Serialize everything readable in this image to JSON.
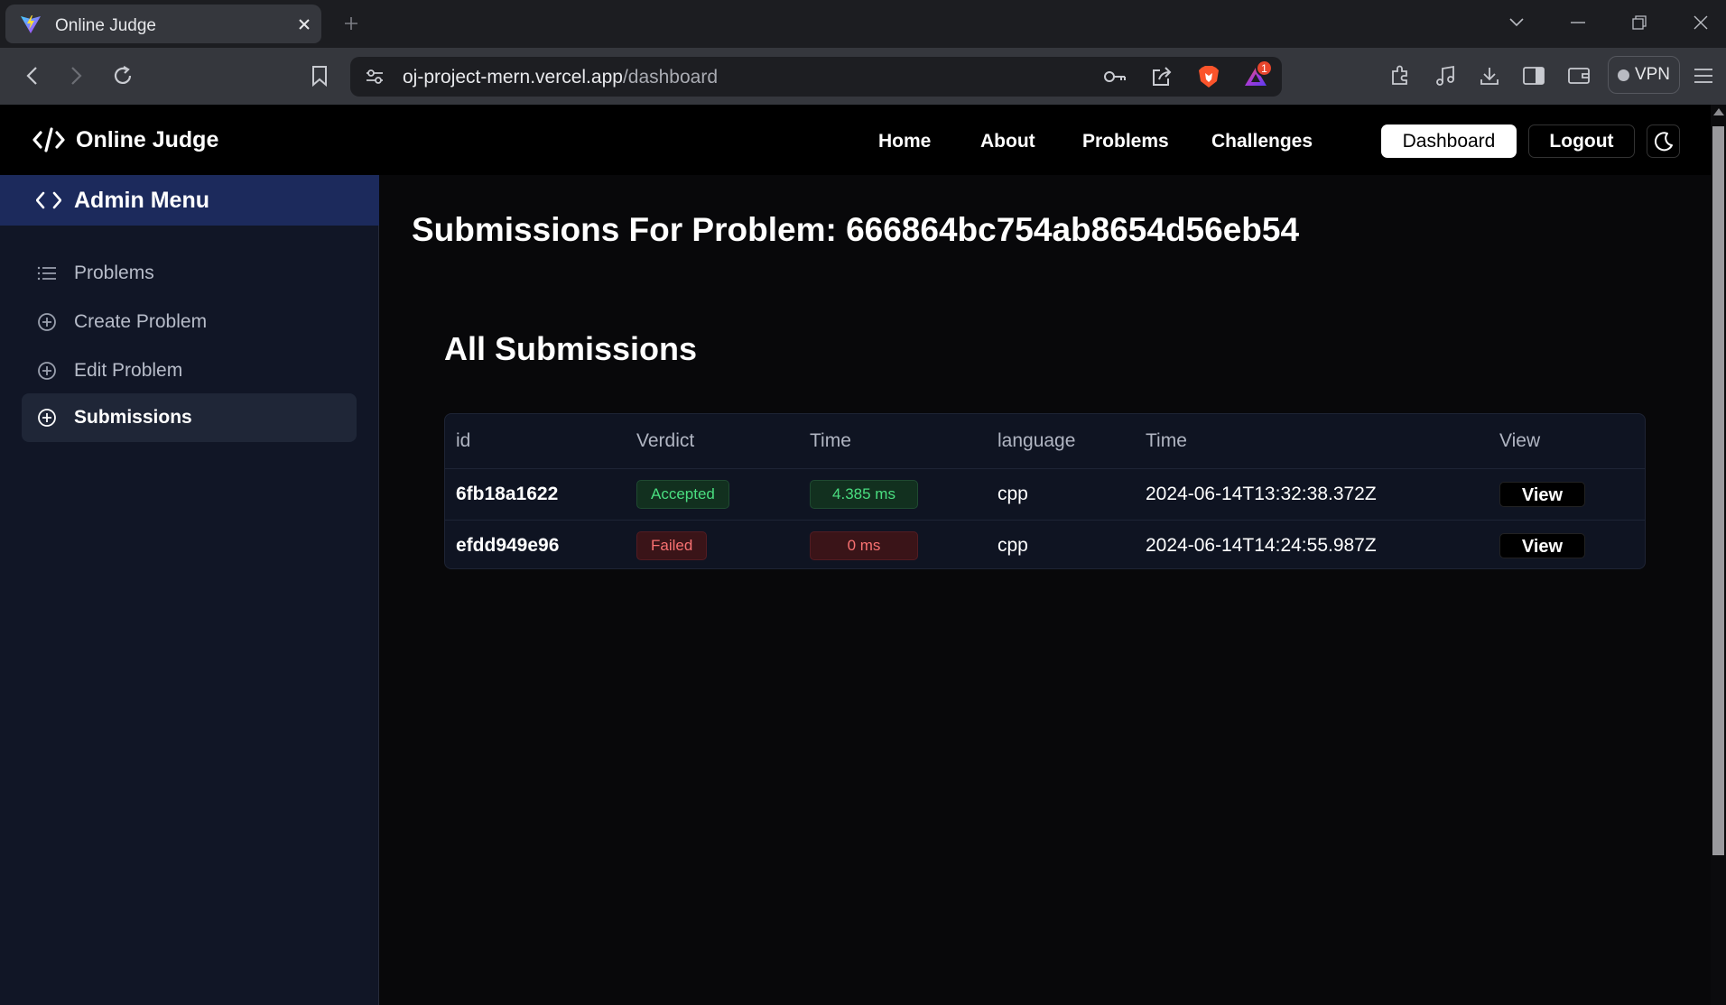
{
  "browser": {
    "tab_title": "Online Judge",
    "url_host": "oj-project-mern.vercel.app",
    "url_path": "/dashboard",
    "notification_count": "1",
    "vpn_label": "VPN"
  },
  "header": {
    "brand": "Online Judge",
    "nav": [
      "Home",
      "About",
      "Problems",
      "Challenges"
    ],
    "dashboard_label": "Dashboard",
    "logout_label": "Logout"
  },
  "sidebar": {
    "title": "Admin Menu",
    "items": [
      {
        "label": "Problems",
        "icon": "list-icon",
        "active": false
      },
      {
        "label": "Create Problem",
        "icon": "plus-circle-icon",
        "active": false
      },
      {
        "label": "Edit Problem",
        "icon": "plus-circle-icon",
        "active": false
      },
      {
        "label": "Submissions",
        "icon": "plus-circle-icon",
        "active": true
      }
    ]
  },
  "main": {
    "title": "Submissions For Problem: 666864bc754ab8654d56eb54",
    "section_title": "All Submissions",
    "columns": [
      "id",
      "Verdict",
      "Time",
      "language",
      "Time",
      "View"
    ],
    "rows": [
      {
        "id": "6fb18a1622",
        "verdict": "Accepted",
        "time": "4.385 ms",
        "language": "cpp",
        "timestamp": "2024-06-14T13:32:38.372Z",
        "view": "View"
      },
      {
        "id": "efdd949e96",
        "verdict": "Failed",
        "time": "0 ms",
        "language": "cpp",
        "timestamp": "2024-06-14T14:24:55.987Z",
        "view": "View"
      }
    ]
  },
  "colors": {
    "accepted": "#4ade80",
    "failed": "#f87171",
    "sidebar_header": "#1c2a5c"
  }
}
